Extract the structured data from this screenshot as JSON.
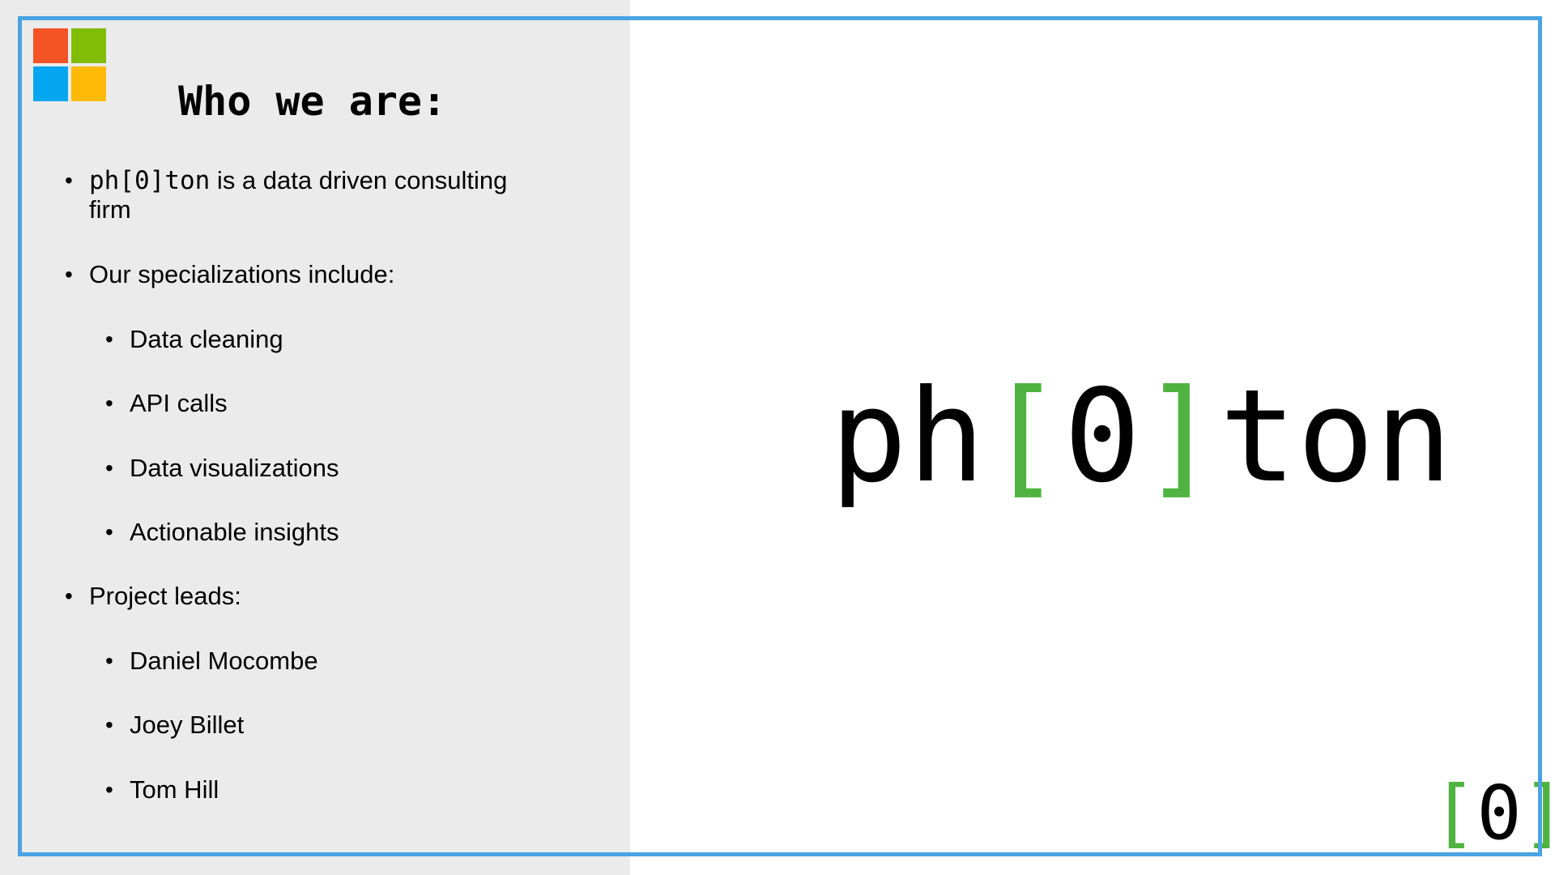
{
  "slide": {
    "heading": "Who we are:",
    "intro": {
      "brand_prefix": "ph[0]ton",
      "text_line1": " is a data driven consulting",
      "text_line2": "firm"
    },
    "specializations_label": "Our specializations include:",
    "specializations": [
      "Data cleaning",
      "API calls",
      "Data visualizations",
      "Actionable insights"
    ],
    "leads_label": "Project leads:",
    "leads": [
      "Daniel Mocombe",
      "Joey Billet",
      "Tom Hill"
    ],
    "brand": {
      "prefix": "ph",
      "open_bracket": "[",
      "zero": "0",
      "close_bracket": "]",
      "suffix": "ton"
    },
    "corner_mark": {
      "open_bracket": "[",
      "zero": "0",
      "close_bracket": "]"
    }
  },
  "colors": {
    "frame": "#4aa3e3",
    "panel": "#ebebeb",
    "accent_green": "#4fb340",
    "logo_red": "#f35325",
    "logo_green": "#81bc06",
    "logo_blue": "#05a6f0",
    "logo_yellow": "#ffba08"
  },
  "icons": [
    "microsoft-logo-icon",
    "bullet-dot-icon"
  ]
}
